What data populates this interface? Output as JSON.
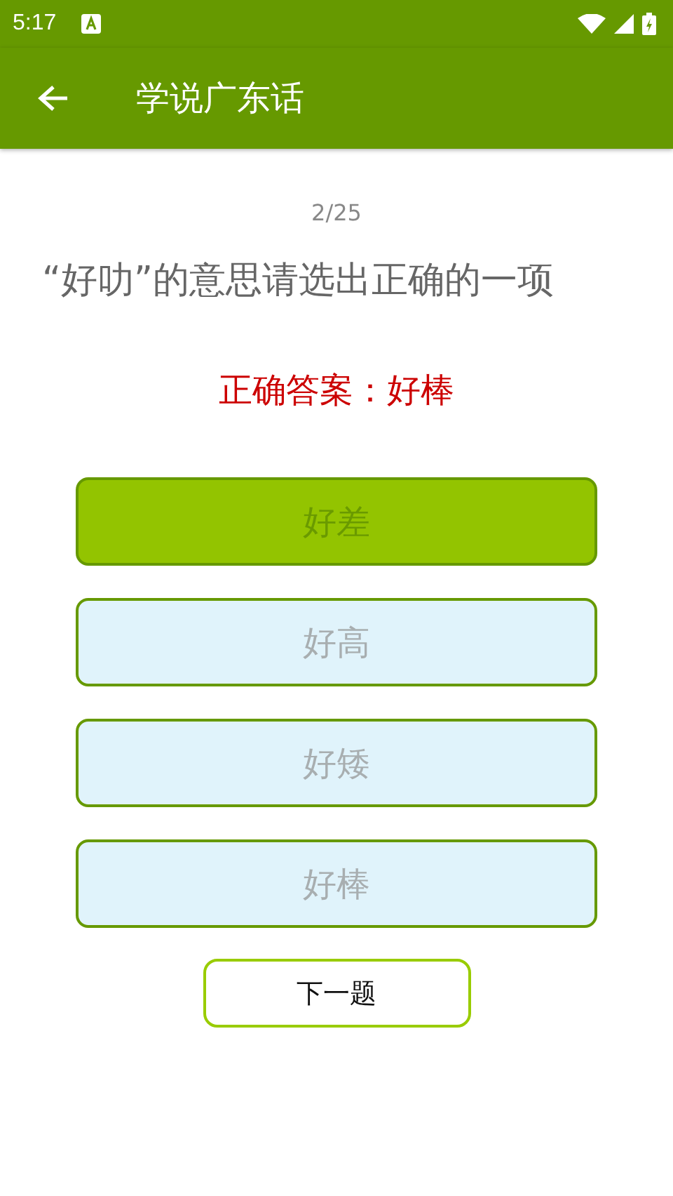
{
  "status_bar": {
    "time": "5:17"
  },
  "app_bar": {
    "title": "学说广东话"
  },
  "progress": "2/25",
  "question": "“好叻”的意思请选出正确的一项",
  "correct_answer": "正确答案：好棒",
  "options": [
    {
      "label": "好差",
      "selected": true
    },
    {
      "label": "好高",
      "selected": false
    },
    {
      "label": "好矮",
      "selected": false
    },
    {
      "label": "好棒",
      "selected": false
    }
  ],
  "next_button": "下一题"
}
